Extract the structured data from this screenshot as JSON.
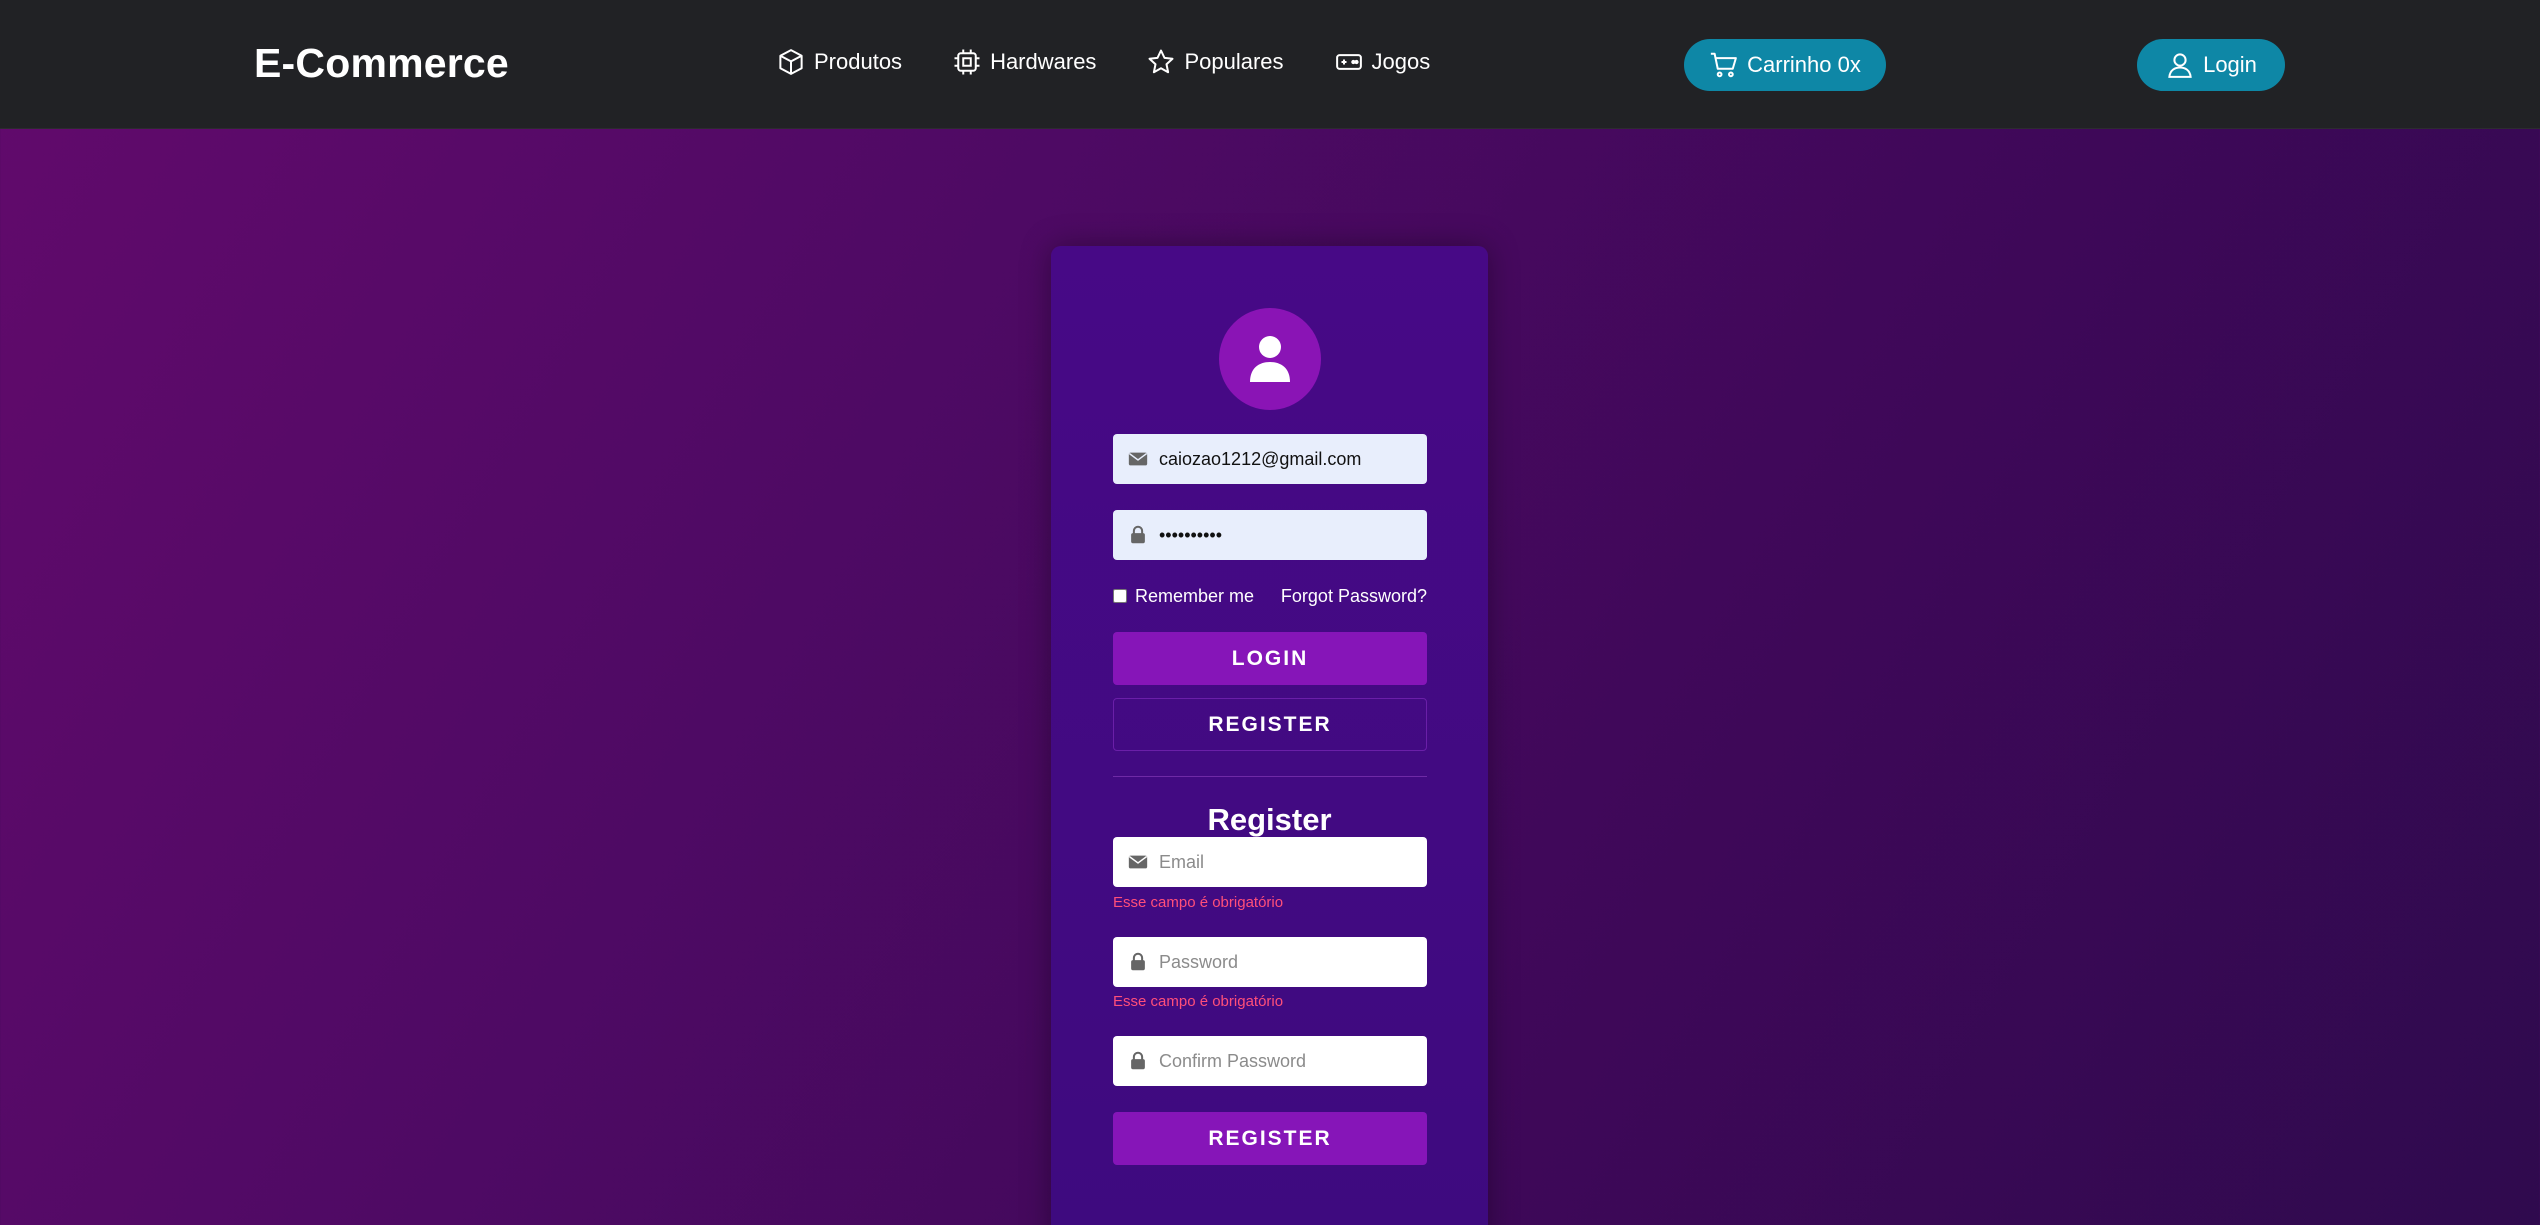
{
  "navbar": {
    "brand": "E-Commerce",
    "links": [
      {
        "label": "Produtos",
        "icon": "box-icon"
      },
      {
        "label": "Hardwares",
        "icon": "cpu-icon"
      },
      {
        "label": "Populares",
        "icon": "star-icon"
      },
      {
        "label": "Jogos",
        "icon": "gamepad-icon"
      }
    ],
    "cart_label": "Carrinho 0x",
    "login_label": "Login"
  },
  "login_form": {
    "email_value": "caiozao1212@gmail.com",
    "password_value": "••••••••••",
    "remember_label": "Remember me",
    "remember_checked": false,
    "forgot_label": "Forgot Password?",
    "login_button": "LOGIN",
    "register_button": "REGISTER"
  },
  "register_form": {
    "title": "Register",
    "email_placeholder": "Email",
    "email_error": "Esse campo é obrigatório",
    "password_placeholder": "Password",
    "password_error": "Esse campo é obrigatório",
    "confirm_placeholder": "Confirm Password",
    "submit_button": "REGISTER"
  },
  "colors": {
    "navbar_bg": "#212225",
    "accent_button": "#0e87a6",
    "card_bg": "#470986",
    "primary_button": "#8615b8",
    "error_text": "#ff4f7a"
  }
}
